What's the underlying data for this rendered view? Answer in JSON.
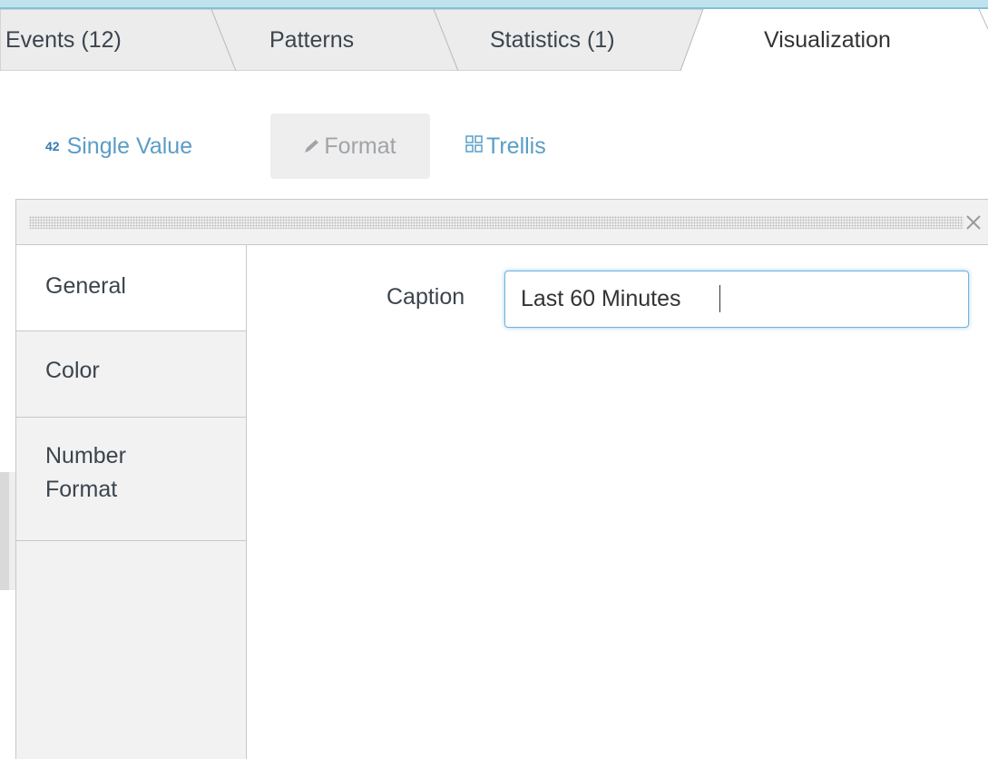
{
  "tabs": [
    {
      "label": "Events (12)",
      "active": false
    },
    {
      "label": "Patterns",
      "active": false
    },
    {
      "label": "Statistics (1)",
      "active": false
    },
    {
      "label": "Visualization",
      "active": true
    }
  ],
  "viz_toolbar": {
    "single_value": {
      "icon_text": "42",
      "label": "Single Value"
    },
    "format": {
      "icon": "pencil-icon",
      "label": "Format"
    },
    "trellis": {
      "icon": "grid-icon",
      "label": "Trellis"
    }
  },
  "format_panel": {
    "close_icon": "close-icon",
    "sidebar": [
      {
        "label": "General",
        "active": true
      },
      {
        "label": "Color",
        "active": false
      },
      {
        "label_line1": "Number",
        "label_line2": "Format",
        "active": false
      }
    ],
    "caption": {
      "label": "Caption",
      "value": "Last 60 Minutes"
    }
  },
  "colors": {
    "accent_blue": "#5a9dc7",
    "top_strip": "#7fc1d6",
    "input_focus": "#6fb3e0"
  }
}
